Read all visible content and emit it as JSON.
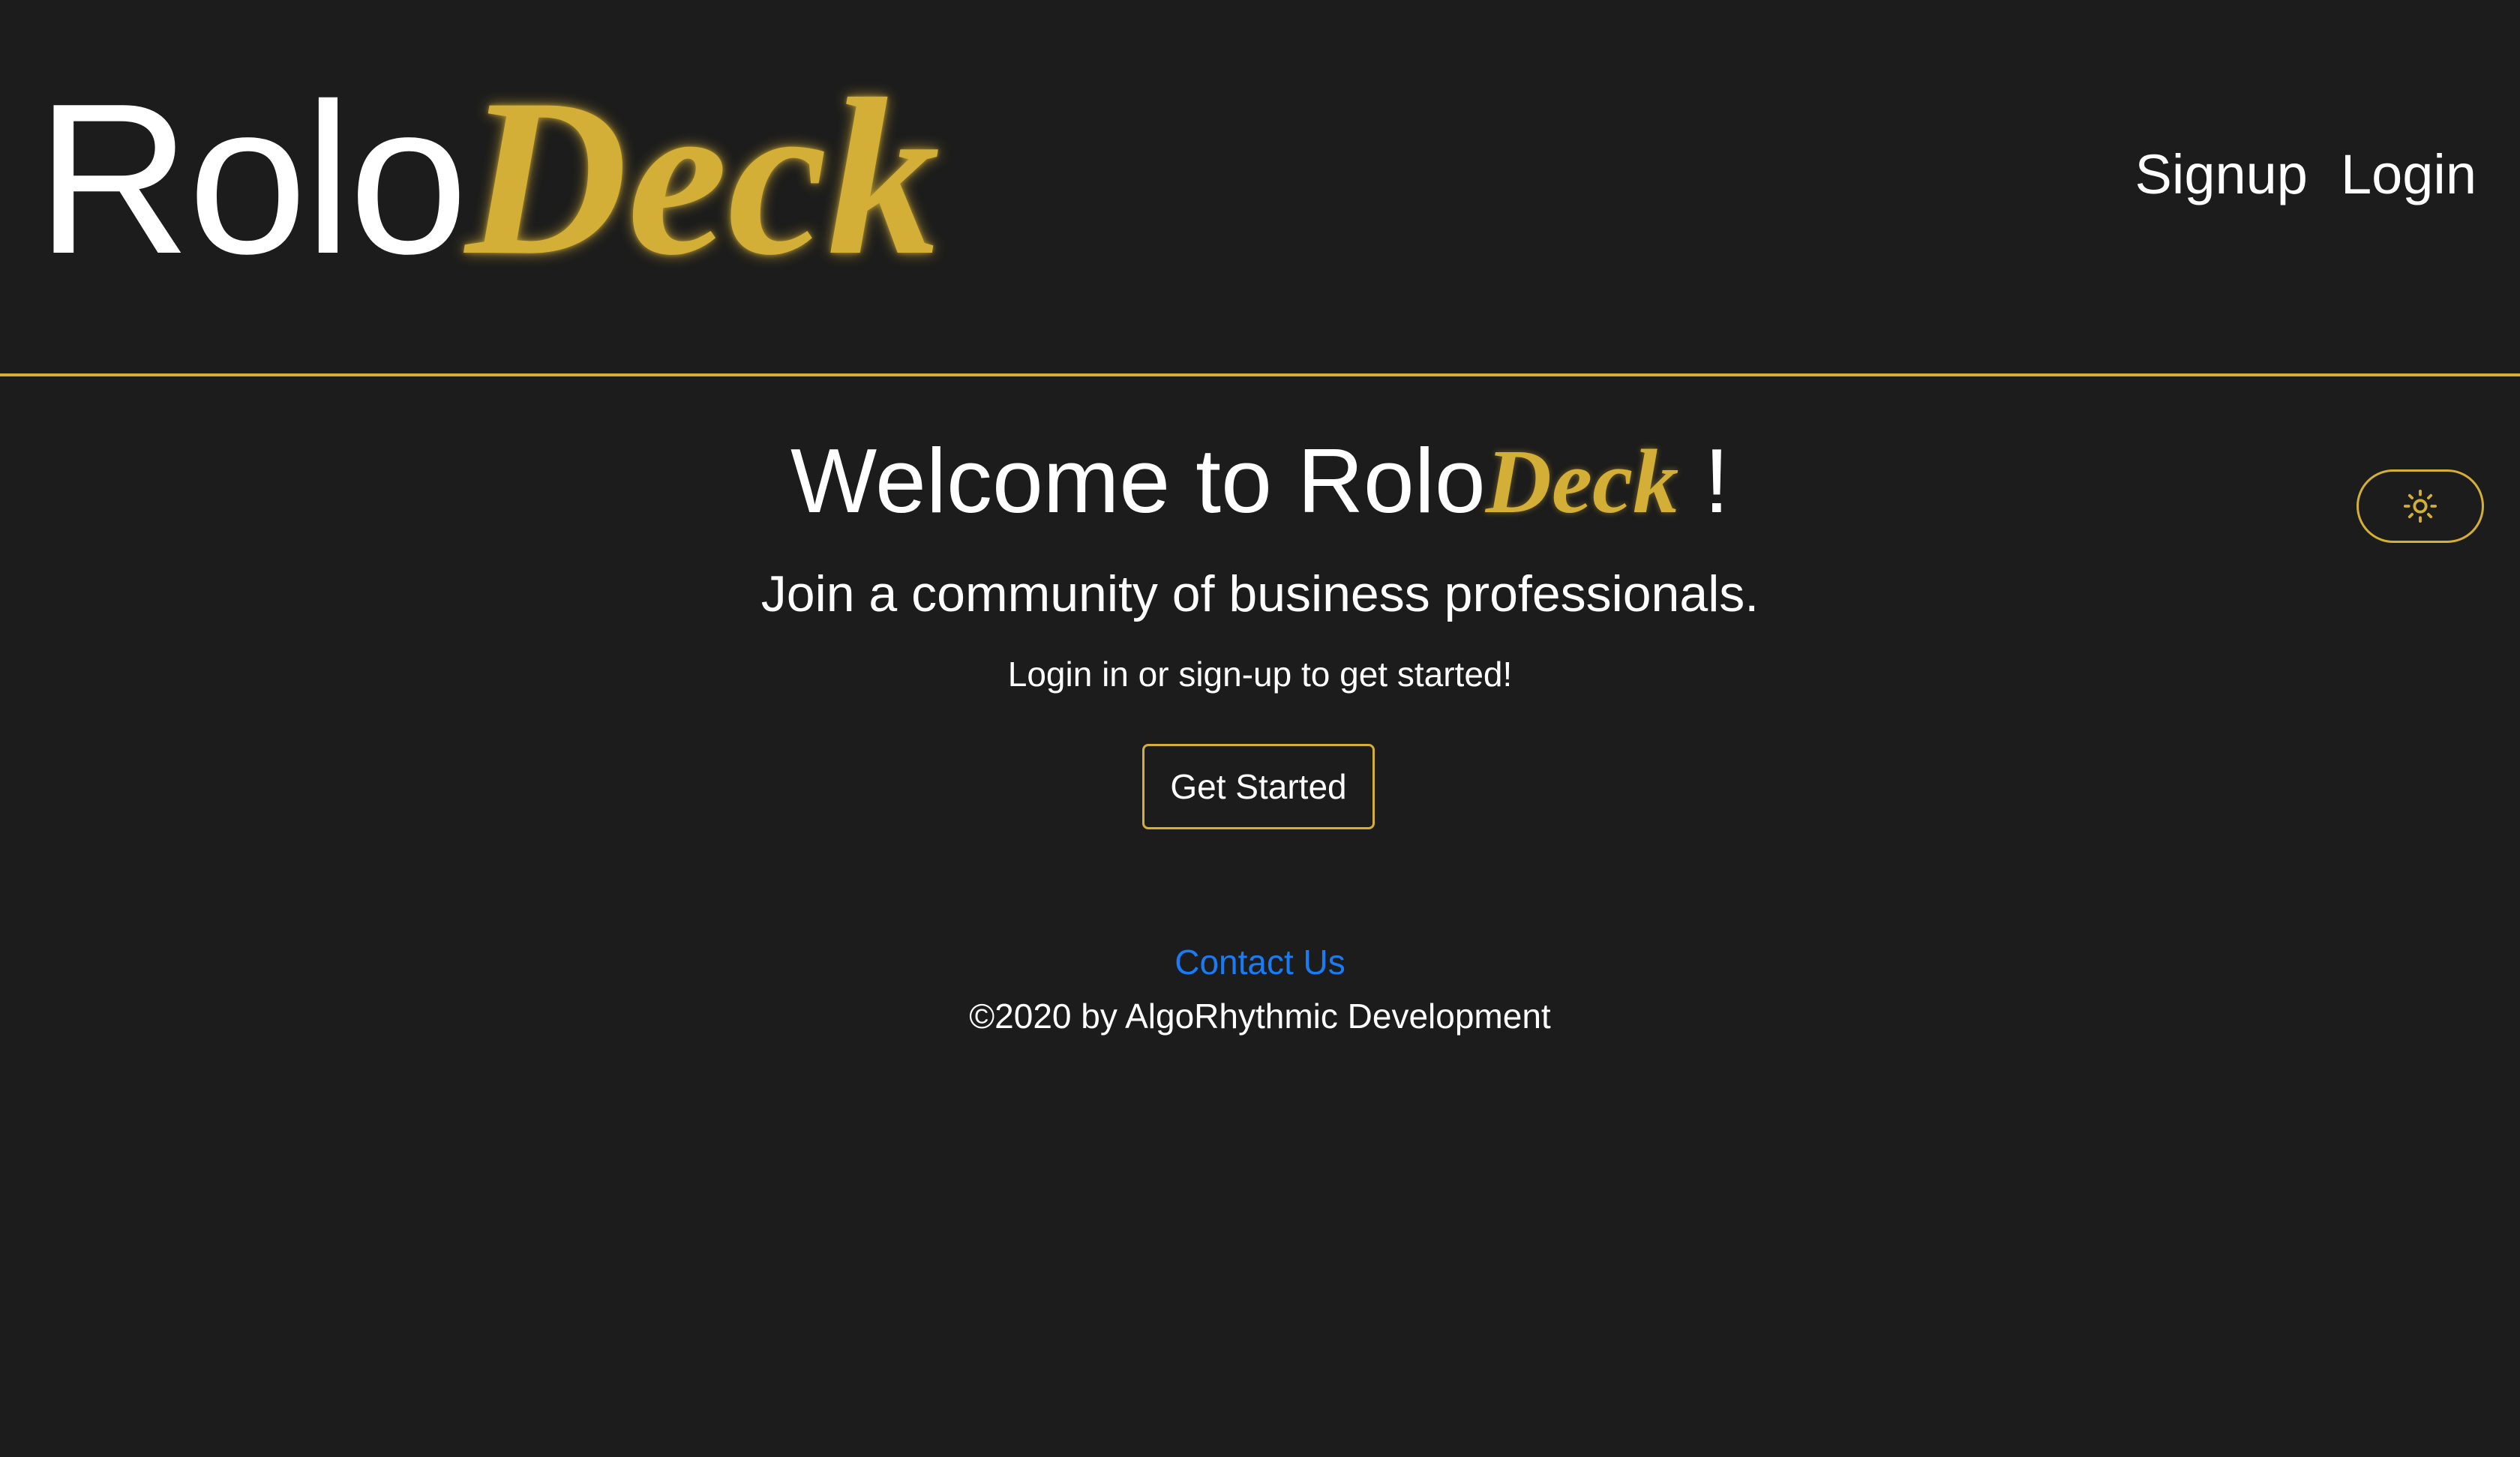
{
  "brand": {
    "part1": "Rolo",
    "part2": "Deck"
  },
  "nav": {
    "signup_label": "Signup",
    "login_label": "Login"
  },
  "hero": {
    "welcome_prefix": "Welcome to Rolo",
    "welcome_deck": "Deck",
    "welcome_suffix": " !",
    "subtitle": "Join a community of business professionals.",
    "prompt": "Login in or sign-up to get started!",
    "cta_label": "Get Started"
  },
  "theme_toggle": {
    "icon": "sun-icon"
  },
  "footer": {
    "contact_label": "Contact Us",
    "copyright": "©2020 by AlgoRhythmic Development"
  },
  "colors": {
    "background": "#1c1c1c",
    "accent": "#d4af37",
    "link": "#1a7cf5",
    "text": "#ffffff"
  }
}
